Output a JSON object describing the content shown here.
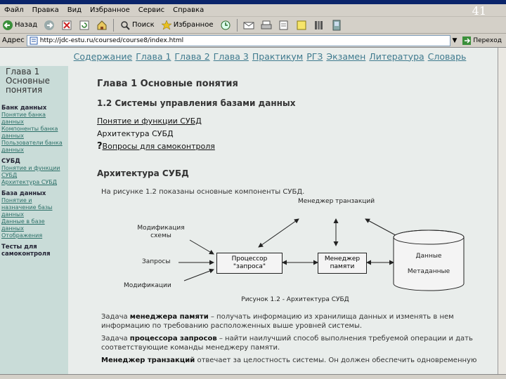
{
  "window": {
    "slide_number": "41"
  },
  "menubar": {
    "items": [
      "Файл",
      "Правка",
      "Вид",
      "Избранное",
      "Сервис",
      "Справка"
    ]
  },
  "toolbar": {
    "back": "Назад",
    "search": "Поиск",
    "favorites": "Избранное"
  },
  "addressbar": {
    "label": "Адрес",
    "url": "http://jdc-estu.ru/coursed/course8/index.html",
    "go": "Переход"
  },
  "site_nav": [
    "Содержание",
    "Глава 1",
    "Глава 2",
    "Глава 3",
    "Практикум",
    "РГЗ",
    "Экзамен",
    "Литература",
    "Словарь"
  ],
  "sidebar": {
    "title": "Глава 1 Основные понятия",
    "sections": [
      {
        "heading": "Банк данных",
        "links": [
          "Понятие банка данных",
          "Компоненты банка данных",
          "Пользователи банка данных"
        ]
      },
      {
        "heading": "СУБД",
        "links": [
          "Понятие и функции СУБД",
          "Архитектура СУБД"
        ]
      },
      {
        "heading": "База данных",
        "links": [
          "Понятие и назначение базы данных",
          "Данные в базе данных",
          "Отображения"
        ]
      },
      {
        "heading": "Тесты для самоконтроля",
        "links": []
      }
    ]
  },
  "main": {
    "chapter_title": "Глава 1 Основные понятия",
    "section_title": "1.2 Системы управления базами данных",
    "links": [
      "Понятие и функции СУБД",
      "Архитектура СУБД",
      "Вопросы для самоконтроля"
    ],
    "question_mark": "?",
    "subsection_title": "Архитектура СУБД",
    "intro": "На рисунке 1.2 показаны основные компоненты СУБД.",
    "diagram": {
      "transaction_manager": "Менеджер транзакций",
      "schema_modification": "Модификация схемы",
      "queries": "Запросы",
      "modifications": "Модификации",
      "query_processor": "Процессор \"запроса\"",
      "memory_manager": "Менеджер памяти",
      "storage_data": "Данные",
      "storage_metadata": "Метаданные",
      "caption": "Рисунок 1.2 - Архитектура СУБД"
    },
    "paragraphs": [
      {
        "prefix": "Задача ",
        "term": "менеджера памяти",
        "text": " – получать информацию из хранилища данных и изменять в нем"
      },
      {
        "prefix": "",
        "term": "",
        "text": "информацию по требованию расположенных выше уровней системы."
      },
      {
        "prefix": "Задача ",
        "term": "процессора запросов",
        "text": " – найти наилучший способ выполнения требуемой операции и дать"
      },
      {
        "prefix": "",
        "term": "",
        "text": "соответствующие команды менеджеру памяти."
      },
      {
        "prefix": "",
        "term": "Менеджер транзакций",
        "text": " отвечает за целостность системы. Он должен обеспечить одновременную"
      }
    ]
  }
}
